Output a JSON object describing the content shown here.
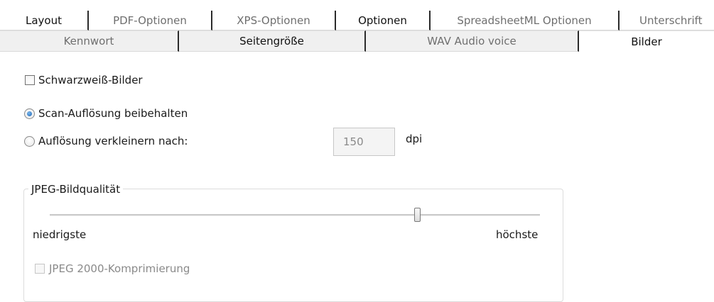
{
  "tabs_row1": [
    {
      "label": "Layout",
      "active": true
    },
    {
      "label": "PDF-Optionen",
      "active": false
    },
    {
      "label": "XPS-Optionen",
      "active": false
    },
    {
      "label": "Optionen",
      "active": true
    },
    {
      "label": "SpreadsheetML Optionen",
      "active": false
    },
    {
      "label": "Unterschrift",
      "active": false
    }
  ],
  "tabs_row2": [
    {
      "label": "Kennwort",
      "active": false
    },
    {
      "label": "Seitengröße",
      "active": true
    },
    {
      "label": "WAV Audio voice",
      "active": false
    },
    {
      "label": "Bilder",
      "selected": true
    }
  ],
  "images": {
    "grayscale_label": "Schwarzweiß-Bilder",
    "grayscale_checked": false,
    "keep_resolution_label": "Scan-Auflösung beibehalten",
    "keep_resolution_selected": true,
    "downsample_label": "Auflösung verkleinern nach:",
    "downsample_selected": false,
    "dpi_value": "150",
    "dpi_unit": "dpi"
  },
  "jpeg": {
    "group_title": "JPEG-Bildqualität",
    "slider_min_label": "niedrigste",
    "slider_max_label": "höchste",
    "slider_level_fraction": 0.75,
    "jpeg2000_label": "JPEG 2000-Komprimierung",
    "jpeg2000_enabled": false
  },
  "colors": {
    "radio_accent": "#1c62b3",
    "tab_border": "#2b2b2b"
  }
}
